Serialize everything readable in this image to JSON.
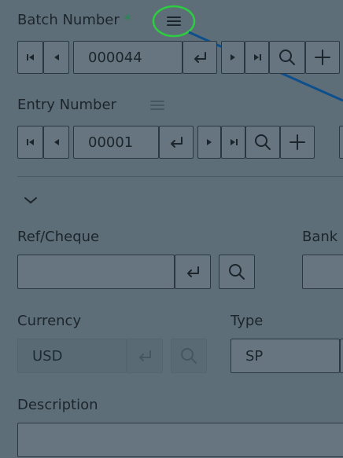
{
  "batch": {
    "label": "Batch Number",
    "required_mark": "*",
    "value": "000044"
  },
  "entry": {
    "label": "Entry Number",
    "value": "00001"
  },
  "ref_cheque": {
    "label": "Ref/Cheque",
    "value": ""
  },
  "bank": {
    "label": "Bank"
  },
  "currency": {
    "label": "Currency",
    "value": "USD"
  },
  "type": {
    "label": "Type",
    "value": "SP"
  },
  "description": {
    "label": "Description",
    "value": ""
  },
  "annotation": {
    "circle_color": "#2ecc40",
    "arrow_color": "#0d4f8c"
  },
  "icons": {
    "menu": "menu-icon",
    "first": "first-page-icon",
    "prev": "previous-icon",
    "next": "next-icon",
    "last": "last-page-icon",
    "enter": "enter-icon",
    "search": "search-icon",
    "add": "plus-icon",
    "collapse": "chevron-down-icon"
  }
}
